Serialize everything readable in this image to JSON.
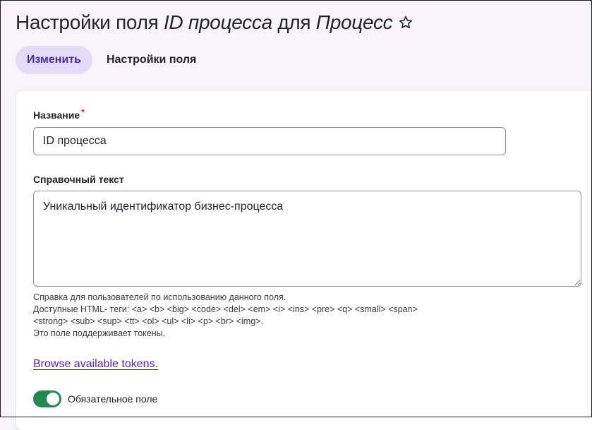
{
  "header": {
    "title_prefix": "Настройки поля ",
    "title_field": "ID процесса",
    "title_middle": " для ",
    "title_entity": "Процесс",
    "favorite_icon": "star-outline-icon"
  },
  "tabs": [
    {
      "label": "Изменить",
      "active": true
    },
    {
      "label": "Настройки поля",
      "active": false
    }
  ],
  "form": {
    "name": {
      "label": "Название",
      "required_marker": "*",
      "value": "ID процесса"
    },
    "help_text": {
      "label": "Справочный текст",
      "value": "Уникальный идентификатор бизнес-процесса",
      "description_lines": [
        "Справка для пользователей по использованию данного поля.",
        "Доступные HTML- теги: <a> <b> <big> <code> <del> <em> <i> <ins> <pre> <q> <small> <span>",
        "<strong> <sub> <sup> <tt> <ol> <ul> <li> <p> <br> <img>.",
        "Это поле поддерживает токены."
      ]
    },
    "tokens_link": "Browse available tokens.",
    "required_toggle": {
      "label": "Обязательное поле",
      "checked": true
    }
  },
  "colors": {
    "accent": "#4b2bb3",
    "active_tab_bg": "#e3dbf8",
    "link": "#5321d4",
    "toggle_on": "#228a51",
    "required_marker": "#dc2323"
  }
}
